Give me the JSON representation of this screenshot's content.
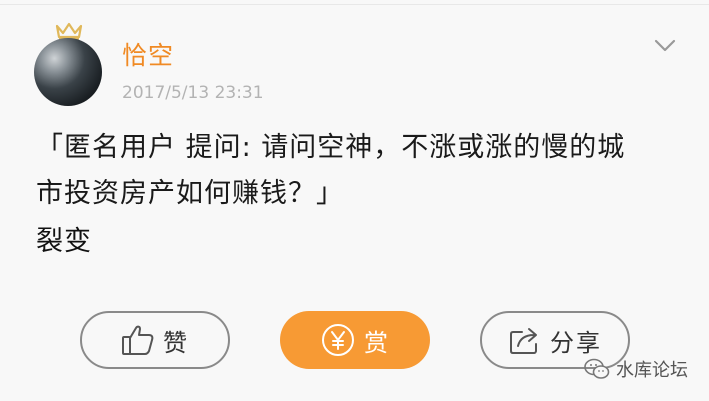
{
  "post": {
    "username": "恰空",
    "timestamp": "2017/5/13 23:31",
    "question_line1": "「匿名用户  提问: 请问空神，不涨或涨的慢的城",
    "question_line2": "市投资房产如何赚钱？」",
    "reply": "裂变"
  },
  "actions": {
    "like_label": "赞",
    "reward_label": "赏",
    "share_label": "分享"
  },
  "watermark": {
    "text": "水库论坛"
  },
  "icons": {
    "crown": "crown-icon",
    "more": "chevron-down-icon",
    "like": "thumbs-up-icon",
    "reward": "yen-coin-icon",
    "share": "share-icon",
    "watermark": "wechat-icon"
  },
  "colors": {
    "accent": "#f79a34",
    "username": "#f08a24",
    "timestamp": "#b3b3b3"
  }
}
